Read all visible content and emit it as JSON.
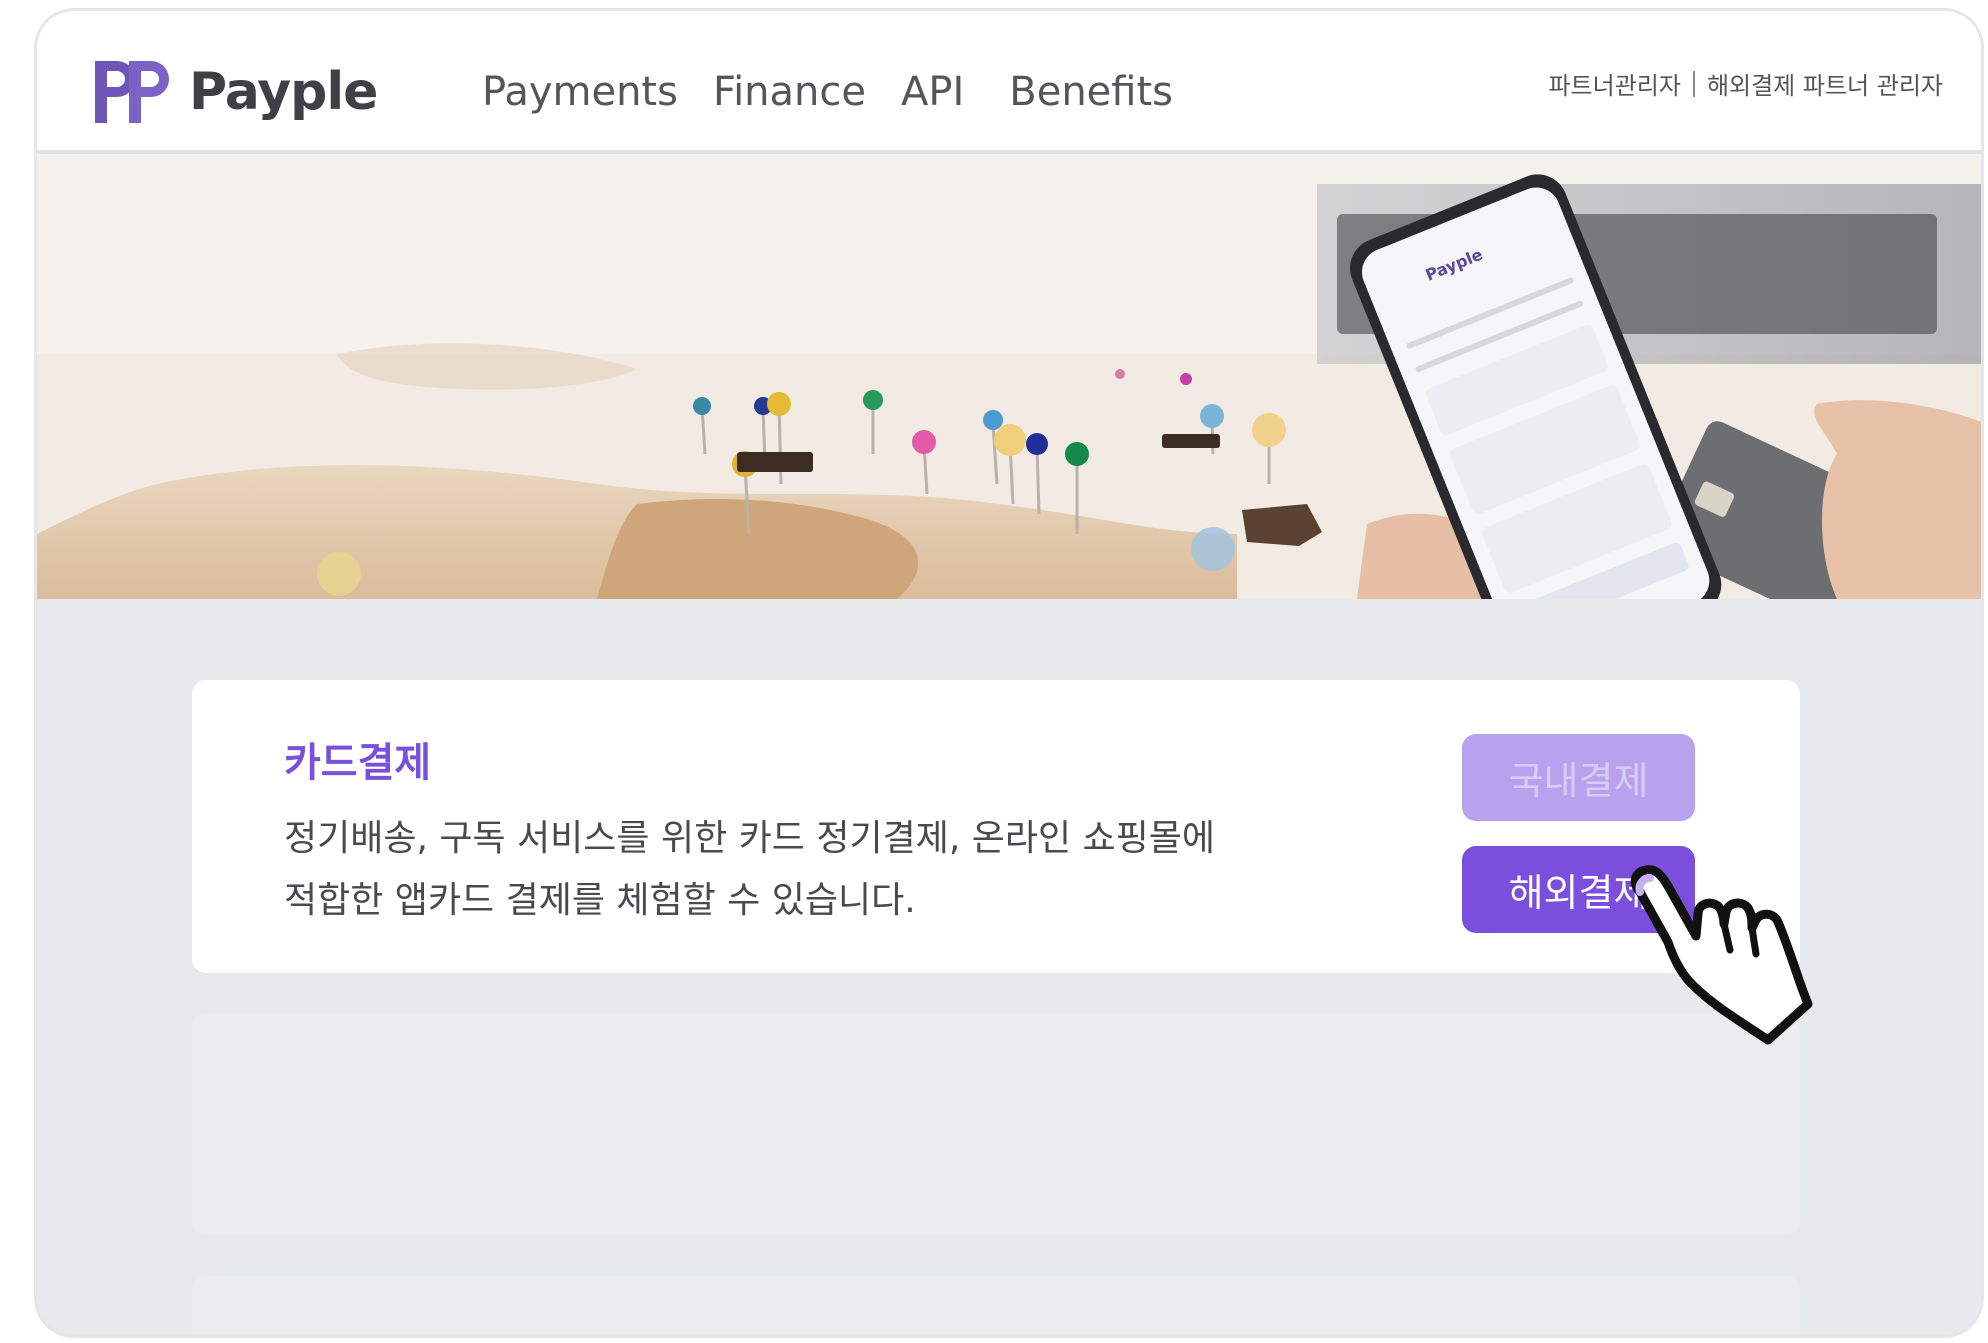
{
  "header": {
    "brand": "Payple",
    "nav": [
      "Payments",
      "Finance",
      "API",
      "Benefits"
    ],
    "partner_links": [
      "파트너관리자",
      "해외결제 파트너 관리자"
    ]
  },
  "hero": {
    "phone_brand": "Payple"
  },
  "card": {
    "title": "카드결제",
    "description_line1": "정기배송, 구독 서비스를 위한 카드 정기결제, 온라인 쇼핑몰에",
    "description_line2": "적합한 앱카드 결제를 체험할 수 있습니다.",
    "buttons": {
      "domestic": "국내결제",
      "overseas": "해외결제"
    }
  },
  "colors": {
    "accent": "#7a4fdc",
    "accent_light": "#b8a2ee",
    "logo": "#6e56b8"
  },
  "icons": [
    "payple-logo-icon",
    "hand-pointer-cursor-icon"
  ]
}
